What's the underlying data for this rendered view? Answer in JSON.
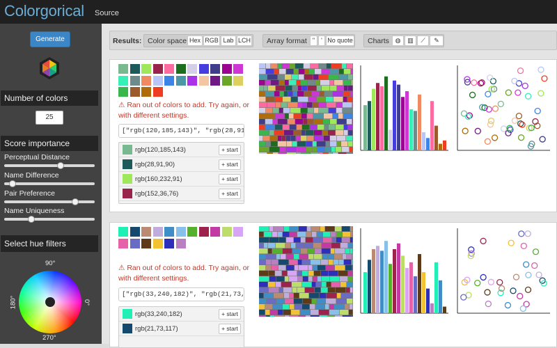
{
  "header": {
    "brand": "Colorgorical",
    "source_link": "Source"
  },
  "sidebar": {
    "generate_label": "Generate",
    "num_colors_heading": "Number of colors",
    "num_colors_value": "25",
    "score_heading": "Score importance",
    "sliders": [
      {
        "label": "Perceptual Distance",
        "value": 0.63
      },
      {
        "label": "Name Difference",
        "value": 0.06
      },
      {
        "label": "Pair Preference",
        "value": 0.81
      },
      {
        "label": "Name Uniqueness",
        "value": 0.28
      }
    ],
    "hue_heading": "Select hue filters",
    "deg_top": "90°",
    "deg_left": "180°",
    "deg_right": "0°",
    "deg_bottom": "270°",
    "logo_icon": "colorgorical-hexagon-logo"
  },
  "results_bar": {
    "label": "Results:",
    "color_space": {
      "label": "Color space",
      "options": [
        "Hex",
        "RGB",
        "Lab",
        "LCH"
      ]
    },
    "array_format": {
      "label": "Array format",
      "options": [
        "\"",
        "'",
        "No quote"
      ]
    },
    "charts": {
      "label": "Charts",
      "icons": [
        "globe-icon",
        "bar-chart-icon",
        "line-chart-icon",
        "palette-icon"
      ]
    }
  },
  "results": [
    {
      "swatches": [
        "#78b98f",
        "#1c5b5a",
        "#a0e85b",
        "#98244c",
        "#fd6ca0",
        "#1d6d1f",
        "#d3cfe7",
        "#453ddd",
        "#3e3e8a",
        "#9d0391",
        "#ce36d5",
        "#36f0b6",
        "#6e8a8a",
        "#f08a63",
        "#b8c5f6",
        "#3c85e6",
        "#4c97a6",
        "#ab32e9",
        "#f3c5a3",
        "#6f1a84",
        "#6ba629",
        "#ddd060",
        "#39b64c",
        "#9b5b2a",
        "#af6c0a",
        "#ef3d22"
      ],
      "warning": "Ran out of colors to add. Try again, or with different settings.",
      "code": "[\"rgb(120,185,143)\", \"rgb(28,91,90)\", \"rgb(",
      "rows": [
        {
          "color": "#78b98f",
          "label": "rgb(120,185,143)"
        },
        {
          "color": "#1c5b5a",
          "label": "rgb(28,91,90)"
        },
        {
          "color": "#a0e85b",
          "label": "rgb(160,232,91)"
        },
        {
          "color": "#98244c",
          "label": "rgb(152,36,76)"
        }
      ],
      "start_label": "start",
      "bars": [
        0.55,
        0.6,
        0.75,
        0.82,
        0.78,
        0.9,
        0.25,
        0.85,
        0.8,
        0.65,
        0.72,
        0.5,
        0.48,
        0.68,
        0.22,
        0.15,
        0.6,
        0.3,
        0.08,
        0.12
      ],
      "bar_colors": [
        "#78b98f",
        "#1c5b5a",
        "#a0e85b",
        "#98244c",
        "#fd6ca0",
        "#1d6d1f",
        "#d3cfe7",
        "#453ddd",
        "#3e3e8a",
        "#9d0391",
        "#ce36d5",
        "#36f0b6",
        "#6e8a8a",
        "#f08a63",
        "#b8c5f6",
        "#3c85e6",
        "#fd6ca0",
        "#9b5b2a",
        "#af6c0a",
        "#ef3d22"
      ]
    },
    {
      "swatches": [
        "#21f0b6",
        "#15496e",
        "#ba8a73",
        "#bfaedc",
        "#3f8ec7",
        "#87c0ea",
        "#55b02b",
        "#9d234d",
        "#c33aa4",
        "#bcdd69",
        "#d8a4f5",
        "#e661a7",
        "#6a6bc5",
        "#5e3a19",
        "#f2c232",
        "#2d2fbb",
        "#b87fc1"
      ],
      "warning": "Ran out of colors to add. Try again, or with different settings.",
      "code": "[\"rgb(33,240,182)\", \"rgb(21,73,117)\", \"rgb(",
      "rows": [
        {
          "color": "#21f0b6",
          "label": "rgb(33,240,182)"
        },
        {
          "color": "#15496e",
          "label": "rgb(21,73,117)"
        }
      ],
      "start_label": "start",
      "bars": [
        0.5,
        0.65,
        0.78,
        0.82,
        0.76,
        0.88,
        0.6,
        0.78,
        0.85,
        0.7,
        0.55,
        0.62,
        0.45,
        0.72,
        0.5,
        0.3,
        0.12,
        0.62,
        0.4,
        0.08
      ],
      "bar_colors": [
        "#21f0b6",
        "#15496e",
        "#ba8a73",
        "#bfaedc",
        "#3f8ec7",
        "#87c0ea",
        "#55b02b",
        "#9d234d",
        "#c33aa4",
        "#bcdd69",
        "#d8a4f5",
        "#e661a7",
        "#6a6bc5",
        "#5e3a19",
        "#f2c232",
        "#2d2fbb",
        "#b87fc1",
        "#21f0b6",
        "#3f8ec7",
        "#5e3a19"
      ]
    }
  ]
}
